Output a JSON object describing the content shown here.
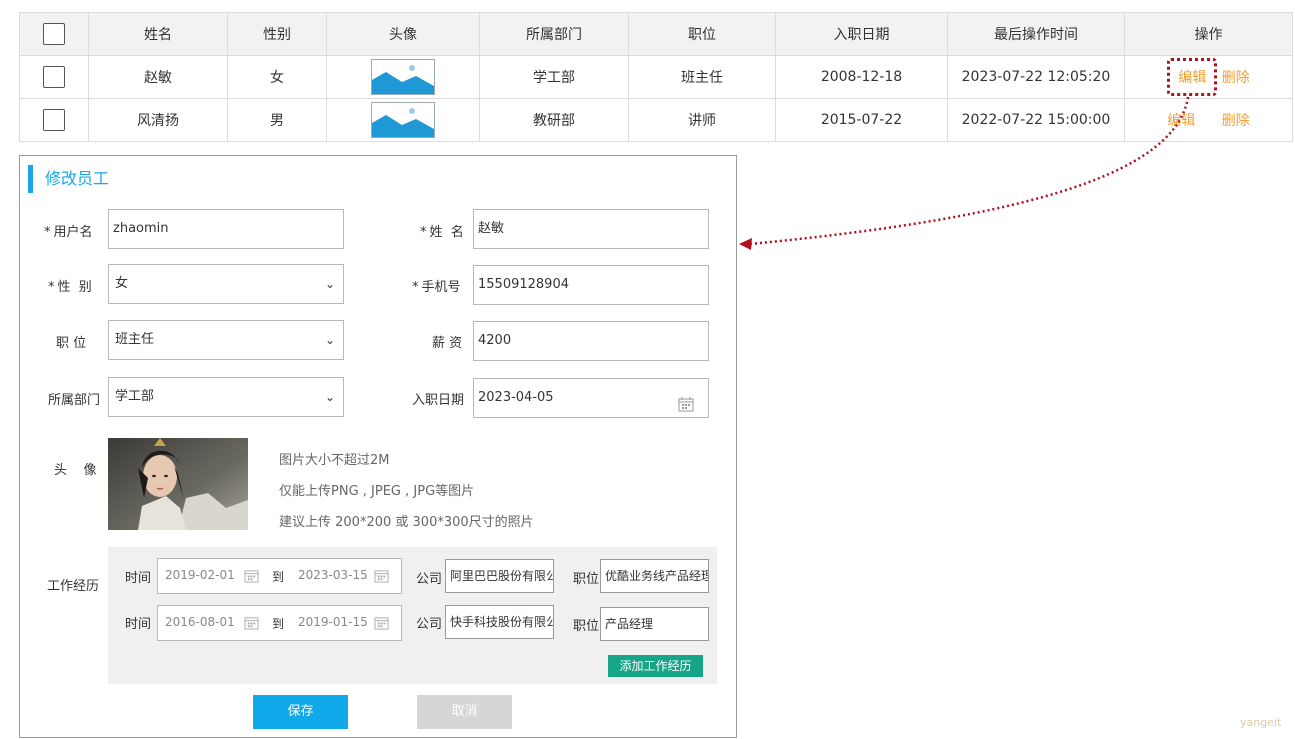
{
  "table": {
    "headers": [
      "姓名",
      "性别",
      "头像",
      "所属部门",
      "职位",
      "入职日期",
      "最后操作时间",
      "操作"
    ],
    "rows": [
      {
        "name": "赵敏",
        "gender": "女",
        "dept": "学工部",
        "position": "班主任",
        "entry_date": "2008-12-18",
        "updated": "2023-07-22 12:05:20",
        "edit": "编辑",
        "delete": "删除"
      },
      {
        "name": "风清扬",
        "gender": "男",
        "dept": "教研部",
        "position": "讲师",
        "entry_date": "2015-07-22",
        "updated": "2022-07-22 15:00:00",
        "edit": "编辑",
        "delete": "删除"
      }
    ]
  },
  "dialog": {
    "title": "修改员工",
    "labels": {
      "username": "用户名",
      "name": "姓  名",
      "gender": "性  别",
      "phone": "手机号",
      "position": "职    位",
      "salary": "薪  资",
      "dept": "所属部门",
      "entry_date": "入职日期",
      "avatar": "头    像",
      "work": "工作经历"
    },
    "required_mark": "*",
    "values": {
      "username": "zhaomin",
      "name": "赵敏",
      "gender": "女",
      "phone": "15509128904",
      "position": "班主任",
      "salary": "4200",
      "dept": "学工部",
      "entry_date": "2023-04-05"
    },
    "avatar_hints": [
      "图片大小不超过2M",
      "仅能上传PNG , JPEG , JPG等图片",
      "建议上传 200*200 或 300*300尺寸的照片"
    ],
    "work": {
      "time_label": "时间",
      "to_label": "到",
      "company_label": "公司",
      "position_label": "职位",
      "rows": [
        {
          "start": "2019-02-01",
          "end": "2023-03-15",
          "company": "阿里巴巴股份有限公司",
          "position": "优酷业务线产品经理"
        },
        {
          "start": "2016-08-01",
          "end": "2019-01-15",
          "company": "快手科技股份有限公司",
          "position": "产品经理"
        }
      ],
      "add_label": "添加工作经历"
    },
    "save_label": "保存",
    "cancel_label": "取消"
  },
  "watermark": "yangeit",
  "colors": {
    "accent": "#1aa7e8",
    "action": "#f0a030",
    "add_button": "#17a587",
    "annotation": "#b0101a"
  }
}
